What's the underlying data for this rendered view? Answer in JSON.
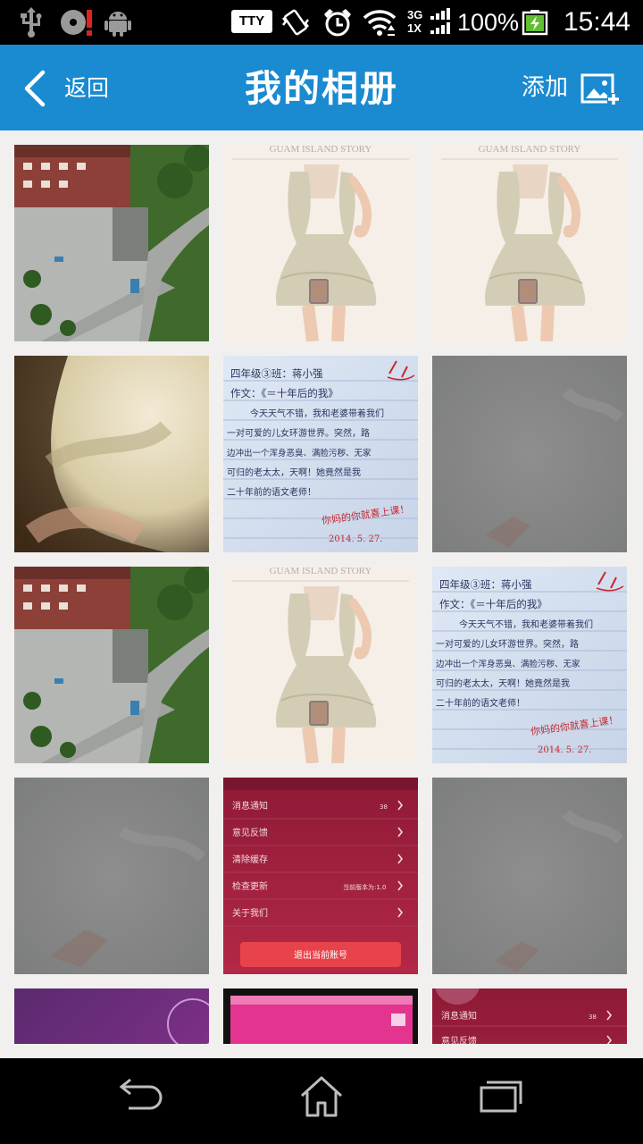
{
  "status_bar": {
    "tty": "TTY",
    "network_top": "3G",
    "network_bottom": "1X",
    "battery": "100%",
    "time": "15:44",
    "icons": [
      "usb-icon",
      "sd-card-alert-icon",
      "android-debug-icon",
      "vibrate-icon",
      "alarm-icon",
      "wifi-icon",
      "signal-icon",
      "battery-charging-icon"
    ]
  },
  "header": {
    "back_label": "返回",
    "title": "我的相册",
    "add_label": "添加",
    "colors": {
      "bar": "#1a8ad1",
      "text": "#ffffff"
    }
  },
  "photos": [
    {
      "kind": "aerial-courtyard"
    },
    {
      "kind": "dress-model",
      "caption": "GUAM ISLAND STORY"
    },
    {
      "kind": "dress-model",
      "caption": "GUAM ISLAND STORY"
    },
    {
      "kind": "blurry-closeup"
    },
    {
      "kind": "handwritten-essay",
      "lines": [
        "四年级③班：蒋小强",
        "作文：《＝十年后的我》",
        "今天天气不错，我和老婆带着我们",
        "一对可爱的儿女环游世界。突然，路",
        "边冲出一个浑身恶臭、满脸污秽、无家",
        "可归的老太太，天啊！她竟然是我",
        "二十年前的语文老师！",
        "你妈的你就喜上课！",
        "2014. 5. 27."
      ]
    },
    {
      "kind": "grey-blur"
    },
    {
      "kind": "aerial-courtyard"
    },
    {
      "kind": "dress-model",
      "caption": "GUAM ISLAND STORY"
    },
    {
      "kind": "handwritten-essay",
      "lines": [
        "四年级③班：蒋小强",
        "作文：《＝十年后的我》",
        "今天天气不错，我和老婆带着我们",
        "一对可爱的儿女环游世界。突然，路",
        "边冲出一个浑身恶臭、满脸污秽、无家",
        "可归的老太太，天啊！她竟然是我",
        "二十年前的语文老师！",
        "你妈的你就喜上课！",
        "2014. 5. 27."
      ]
    },
    {
      "kind": "grey-blur"
    },
    {
      "kind": "settings-screenshot",
      "rows": [
        {
          "label": "消息通知",
          "value": "38"
        },
        {
          "label": "意见反馈",
          "value": ""
        },
        {
          "label": "清除缓存",
          "value": ""
        },
        {
          "label": "检查更新",
          "value": "当前版本为:1.0"
        },
        {
          "label": "关于我们",
          "value": ""
        }
      ],
      "button": "退出当前账号"
    },
    {
      "kind": "grey-blur"
    },
    {
      "kind": "purple-gradient"
    },
    {
      "kind": "pink-screen"
    },
    {
      "kind": "settings-screenshot-partial",
      "rows": [
        {
          "label": "消息通知",
          "value": "38"
        },
        {
          "label": "意见反馈",
          "value": ""
        }
      ]
    }
  ],
  "nav_bar": {
    "icons": [
      "back-nav-icon",
      "home-nav-icon",
      "recent-apps-icon"
    ]
  }
}
